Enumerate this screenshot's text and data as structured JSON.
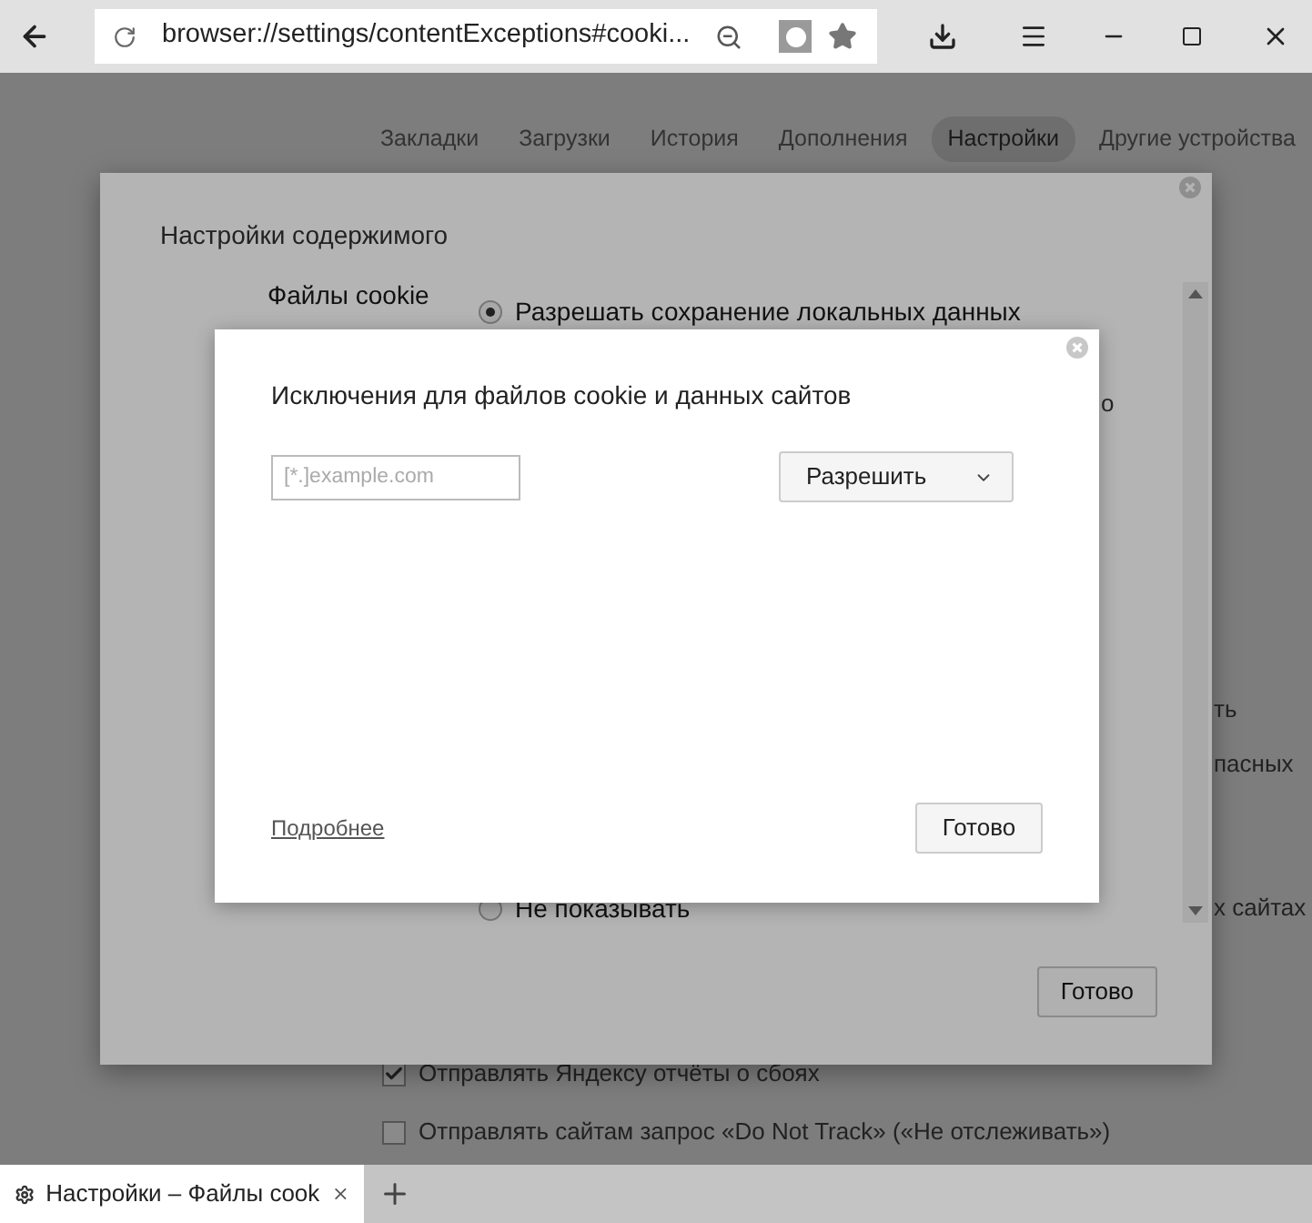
{
  "toolbar": {
    "address": "browser://settings/contentExceptions#cooki..."
  },
  "nav_tabs": [
    {
      "label": "Закладки",
      "selected": false
    },
    {
      "label": "Загрузки",
      "selected": false
    },
    {
      "label": "История",
      "selected": false
    },
    {
      "label": "Дополнения",
      "selected": false
    },
    {
      "label": "Настройки",
      "selected": true
    },
    {
      "label": "Другие устройства",
      "selected": false
    }
  ],
  "settings_dialog": {
    "title": "Настройки содержимого",
    "section_label": "Файлы cookie",
    "options": [
      {
        "label": "Разрешать сохранение локальных данных",
        "selected": true
      },
      {
        "label": "Не показывать",
        "selected": false
      }
    ],
    "done_button": "Готово"
  },
  "background_fragments": [
    "о",
    "ть",
    "пасных",
    "х сайтах"
  ],
  "exceptions_dialog": {
    "title": "Исключения для файлов cookie и данных сайтов",
    "pattern_field": {
      "placeholder": "[*.]example.com"
    },
    "behavior_select": {
      "value": "Разрешить"
    },
    "learn_more_link": "Подробнее",
    "done_button": "Готово"
  },
  "page_checkboxes": [
    {
      "label": "Отправлять Яндексу отчёты о сбоях",
      "checked": true
    },
    {
      "label": "Отправлять сайтам запрос «Do Not Track» («Не отслеживать»)",
      "checked": false
    }
  ],
  "browser_tabs": [
    {
      "title": "Настройки – Файлы cook",
      "selected": true
    }
  ]
}
